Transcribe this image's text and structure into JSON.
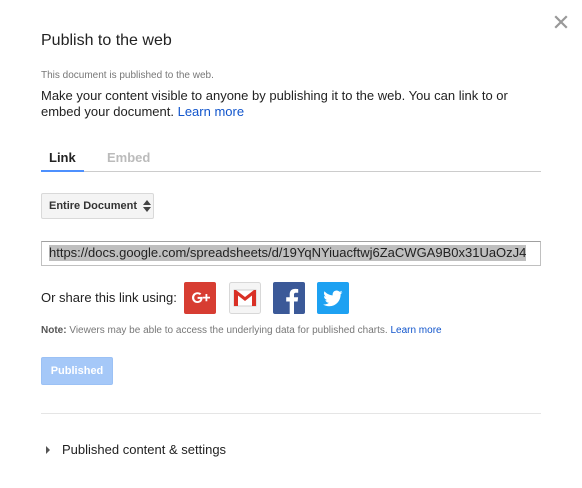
{
  "dialog": {
    "title": "Publish to the web",
    "status": "This document is published to the web.",
    "description": "Make your content visible to anyone by publishing it to the web. You can link to or embed your document.",
    "learn_more": "Learn more"
  },
  "tabs": [
    {
      "label": "Link",
      "active": true
    },
    {
      "label": "Embed",
      "active": false
    }
  ],
  "scope_select": {
    "value": "Entire Document"
  },
  "url": "https://docs.google.com/spreadsheets/d/19YqNYiuacftwj6ZaCWGA9B0x31UaOzJ4",
  "share": {
    "label": "Or share this link using:",
    "services": [
      "google-plus",
      "gmail",
      "facebook",
      "twitter"
    ]
  },
  "note": {
    "prefix": "Note:",
    "text": " Viewers may be able to access the underlying data for published charts. ",
    "learn_more": "Learn more"
  },
  "publish_button": {
    "label": "Published"
  },
  "expander": {
    "label": "Published content & settings"
  },
  "colors": {
    "accent_blue": "#4d90fe",
    "link": "#15c",
    "published_button": "#a5c8f8",
    "google_plus": "#d73d32",
    "gmail_red": "#d93025",
    "facebook": "#3b5998",
    "twitter": "#1da1f2"
  }
}
